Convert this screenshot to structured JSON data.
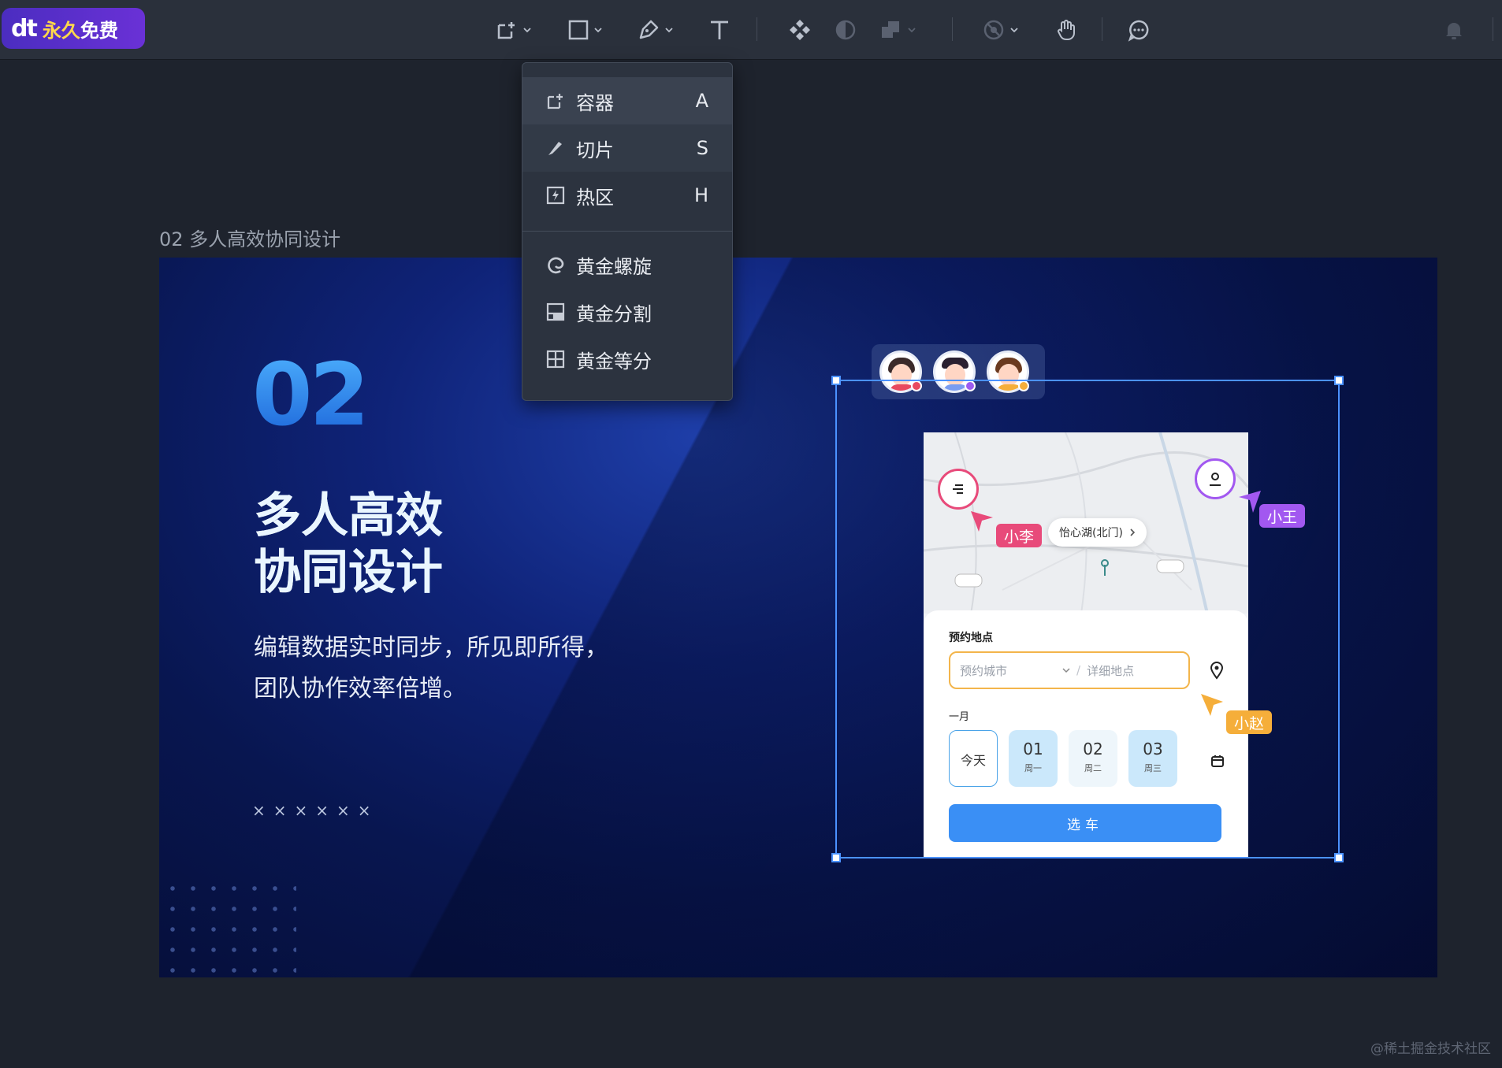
{
  "toolbar": {
    "logo_dt": "dt",
    "logo_text_a": "永久",
    "logo_text_b": "免费"
  },
  "dropdown": {
    "items": [
      {
        "label": "容器",
        "shortcut": "A",
        "icon": "container-icon"
      },
      {
        "label": "切片",
        "shortcut": "S",
        "icon": "slice-icon"
      },
      {
        "label": "热区",
        "shortcut": "H",
        "icon": "hotspot-icon"
      },
      {
        "label": "黄金螺旋",
        "shortcut": "",
        "icon": "golden-spiral-icon"
      },
      {
        "label": "黄金分割",
        "shortcut": "",
        "icon": "golden-ratio-icon"
      },
      {
        "label": "黄金等分",
        "shortcut": "",
        "icon": "golden-grid-icon"
      }
    ]
  },
  "canvas": {
    "frame_label": "02 多人高效协同设计"
  },
  "artboard": {
    "number": "02",
    "headline_1": "多人高效",
    "headline_2": "协同设计",
    "sub_1": "编辑数据实时同步，所见即所得，",
    "sub_2": "团队协作效率倍增。",
    "xmarks": "××××××"
  },
  "collaborators": [
    {
      "name": "小李",
      "color": "#e84a7a"
    },
    {
      "name": "小王",
      "color": "#a258f0"
    },
    {
      "name": "小赵",
      "color": "#f5ae3a"
    }
  ],
  "avatar_dot_colors": [
    "#e84a5f",
    "#9d5cf0",
    "#f5ae3a"
  ],
  "phone": {
    "location_pill": "怡心湖(北门)",
    "card_title": "预约地点",
    "city_placeholder": "预约城市",
    "detail_placeholder": "详细地点",
    "month": "一月",
    "today": "今天",
    "days": [
      {
        "num": "01",
        "week": "周一"
      },
      {
        "num": "02",
        "week": "周二"
      },
      {
        "num": "03",
        "week": "周三"
      }
    ],
    "button": "选车"
  },
  "watermark": "@稀土掘金技术社区",
  "colors": {
    "accent": "#4b92ff",
    "toolbar_bg": "#2a303b",
    "canvas_bg": "#1e232d"
  }
}
